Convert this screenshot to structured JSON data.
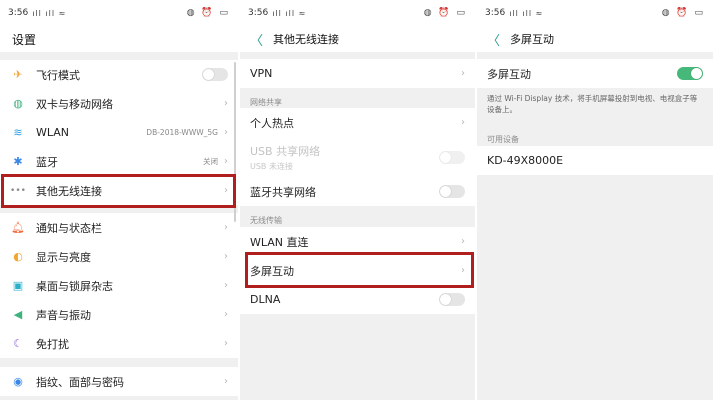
{
  "status": {
    "time": "3:56",
    "signal_icons": "ıll ıll ≈",
    "right_icons": "◍ ⏰ ▭"
  },
  "settings": {
    "title": "设置",
    "items": [
      {
        "label": "飞行模式",
        "icon": "✈",
        "icon_color": "#f2a33a",
        "type": "toggle"
      },
      {
        "label": "双卡与移动网络",
        "icon": "●",
        "icon_color": "#3fb37f",
        "type": "chev"
      },
      {
        "label": "WLAN",
        "icon": "◠",
        "icon_color": "#2fa0e6",
        "value": "DB-2018-WWW_5G",
        "type": "chev"
      },
      {
        "label": "蓝牙",
        "icon": "✱",
        "icon_color": "#3a86e6",
        "value": "关闭",
        "type": "chev"
      },
      {
        "label": "其他无线连接",
        "icon": "•••",
        "icon_color": "#8a8a8a",
        "type": "chev"
      },
      {
        "label": "通知与状态栏",
        "icon": "●",
        "icon_color": "#f06a3c",
        "type": "chev"
      },
      {
        "label": "显示与亮度",
        "icon": "◐",
        "icon_color": "#f4a72e",
        "type": "chev"
      },
      {
        "label": "桌面与锁屏杂志",
        "icon": "▣",
        "icon_color": "#2bb0c9",
        "type": "chev"
      },
      {
        "label": "声音与振动",
        "icon": "◀",
        "icon_color": "#3fb37f",
        "type": "chev"
      },
      {
        "label": "免打扰",
        "icon": "☾",
        "icon_color": "#8a62d8",
        "type": "chev"
      },
      {
        "label": "指纹、面部与密码",
        "icon": "◉",
        "icon_color": "#3a86e6",
        "type": "chev"
      }
    ]
  },
  "other_wireless": {
    "title": "其他无线连接",
    "vpn": "VPN",
    "section_share": "网络共享",
    "hotspot": "个人热点",
    "usb_share": "USB 共享网络",
    "usb_share_sub": "USB 未连接",
    "bt_share": "蓝牙共享网络",
    "section_transfer": "无线传输",
    "wlan_direct": "WLAN 直连",
    "multi_screen": "多屏互动",
    "dlna": "DLNA"
  },
  "multi_screen": {
    "title": "多屏互动",
    "toggle_label": "多屏互动",
    "description": "通过 Wi-Fi Display 技术，将手机屏幕投射到电视、电视盒子等设备上。",
    "section_devices": "可用设备",
    "device": "KD-49X8000E"
  },
  "glyphs": {
    "back": "〈",
    "chevron": "›"
  },
  "colors": {
    "highlight": "#b01e1e",
    "accent": "#2a9d8f",
    "toggle_on": "#46b87a"
  }
}
